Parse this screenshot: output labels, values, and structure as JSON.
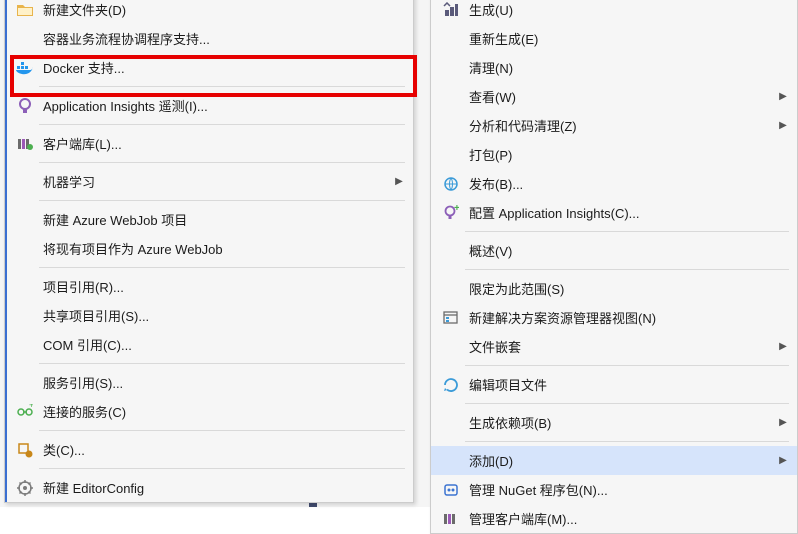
{
  "left_menu": {
    "items": [
      {
        "icon": "folder-icon",
        "label": "新建文件夹(D)"
      },
      {
        "icon": "",
        "label": "容器业务流程协调程序支持...",
        "sep_after": false
      },
      {
        "icon": "docker-icon",
        "label": "Docker 支持...",
        "highlight_red": true,
        "sep_after": true
      },
      {
        "icon": "appinsights-icon",
        "label": "Application Insights 遥测(I)...",
        "sep_after": true
      },
      {
        "icon": "library-icon",
        "label": "客户端库(L)...",
        "sep_after": true
      },
      {
        "icon": "",
        "label": "机器学习",
        "arrow": true,
        "sep_after": true
      },
      {
        "icon": "",
        "label": "新建 Azure WebJob 项目"
      },
      {
        "icon": "",
        "label": "将现有项目作为 Azure WebJob",
        "sep_after": true
      },
      {
        "icon": "",
        "label": "项目引用(R)..."
      },
      {
        "icon": "",
        "label": "共享项目引用(S)..."
      },
      {
        "icon": "",
        "label": "COM 引用(C)...",
        "sep_after": true
      },
      {
        "icon": "",
        "label": "服务引用(S)..."
      },
      {
        "icon": "connected-icon",
        "label": "连接的服务(C)",
        "sep_after": true
      },
      {
        "icon": "class-icon",
        "label": "类(C)...",
        "sep_after": true
      },
      {
        "icon": "editorconfig-icon",
        "label": "新建 EditorConfig"
      }
    ]
  },
  "right_menu": {
    "items": [
      {
        "icon": "build-icon",
        "label": "生成(U)"
      },
      {
        "icon": "",
        "label": "重新生成(E)"
      },
      {
        "icon": "",
        "label": "清理(N)"
      },
      {
        "icon": "",
        "label": "查看(W)",
        "arrow": true
      },
      {
        "icon": "",
        "label": "分析和代码清理(Z)",
        "arrow": true
      },
      {
        "icon": "",
        "label": "打包(P)"
      },
      {
        "icon": "publish-icon",
        "label": "发布(B)..."
      },
      {
        "icon": "appinsights-config-icon",
        "label": "配置 Application Insights(C)...",
        "sep_after": true
      },
      {
        "icon": "",
        "label": "概述(V)",
        "sep_after": true
      },
      {
        "icon": "",
        "label": "限定为此范围(S)"
      },
      {
        "icon": "explorer-icon",
        "label": "新建解决方案资源管理器视图(N)"
      },
      {
        "icon": "",
        "label": "文件嵌套",
        "arrow": true,
        "sep_after": true
      },
      {
        "icon": "edit-proj-icon",
        "label": "编辑项目文件",
        "sep_after": true
      },
      {
        "icon": "",
        "label": "生成依赖项(B)",
        "arrow": true,
        "sep_after": true
      },
      {
        "icon": "",
        "label": "添加(D)",
        "arrow": true,
        "highlight": true
      },
      {
        "icon": "nuget-icon",
        "label": "管理 NuGet 程序包(N)..."
      },
      {
        "icon": "client-lib-icon",
        "label": "管理客户端库(M)..."
      }
    ]
  }
}
